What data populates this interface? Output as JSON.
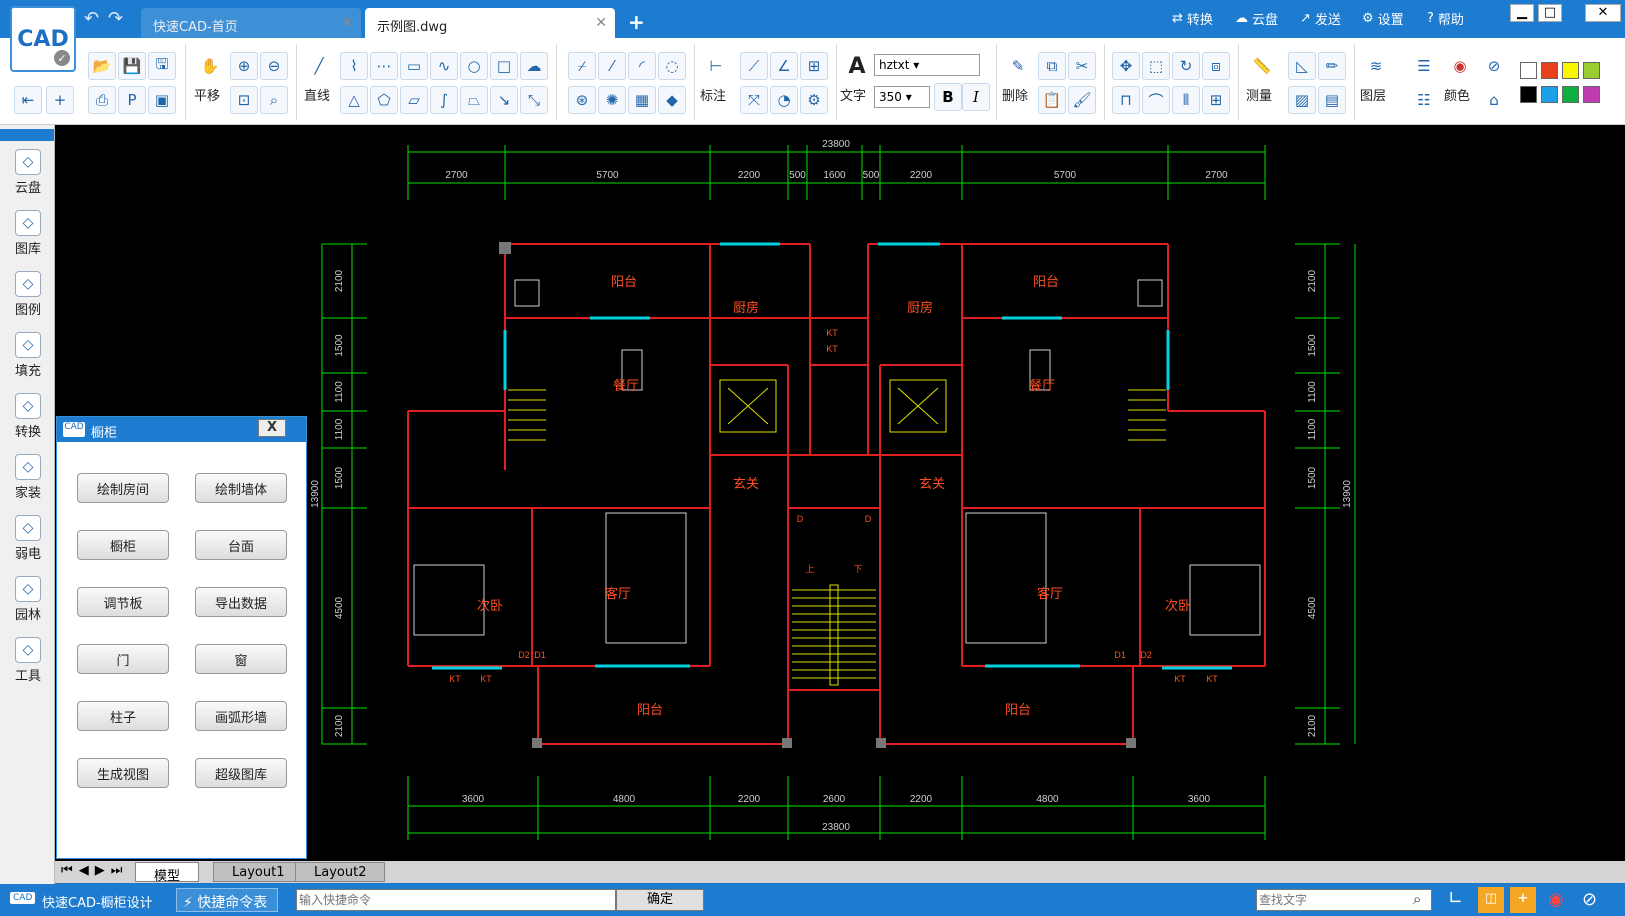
{
  "title_tabs": [
    {
      "label": "快速CAD-首页"
    },
    {
      "label": "示例图.dwg"
    }
  ],
  "top_right": {
    "convert": "转换",
    "cloud": "云盘",
    "send": "发送",
    "settings": "设置",
    "help": "帮助"
  },
  "ribbon": {
    "pan": "平移",
    "line": "直线",
    "dimension": "标注",
    "text": "文字",
    "font": "hztxt",
    "size": "350",
    "bold": "B",
    "italic": "I",
    "delete": "删除",
    "measure": "测量",
    "layer": "图层",
    "color": "颜色"
  },
  "swatches": [
    "#ffffff",
    "#e8401c",
    "#f8f800",
    "#9acd32",
    "#000000",
    "#1ea0e8",
    "#10b040",
    "#c03ab0"
  ],
  "leftbar": [
    {
      "label": "云盘",
      "icon": "cloud-icon"
    },
    {
      "label": "图库",
      "icon": "gallery-icon"
    },
    {
      "label": "图例",
      "icon": "legend-icon"
    },
    {
      "label": "填充",
      "icon": "hatch-icon"
    },
    {
      "label": "转换",
      "icon": "convert-icon"
    },
    {
      "label": "家装",
      "icon": "home-icon"
    },
    {
      "label": "弱电",
      "icon": "lowvoltage-icon"
    },
    {
      "label": "园林",
      "icon": "garden-icon"
    },
    {
      "label": "工具",
      "icon": "tools-icon"
    }
  ],
  "panel": {
    "title": "橱柜",
    "close": "X",
    "buttons": [
      "绘制房间",
      "绘制墙体",
      "橱柜",
      "台面",
      "调节板",
      "导出数据",
      "门",
      "窗",
      "柱子",
      "画弧形墙",
      "生成视图",
      "超级图库"
    ]
  },
  "drawing": {
    "total": "23800",
    "top_dims": [
      "2700",
      "5700",
      "2200",
      "500",
      "1600",
      "500",
      "2200",
      "5700",
      "2700"
    ],
    "bottom_dims": [
      "3600",
      "4800",
      "2200",
      "2600",
      "2200",
      "4800",
      "3600"
    ],
    "side_dims": [
      "2100",
      "1500",
      "1100",
      "1100",
      "1500",
      "4500",
      "2100"
    ],
    "side_total": "13900",
    "rooms": [
      "阳台",
      "厨房",
      "餐厅",
      "玄关",
      "次卧",
      "客厅",
      "阳台",
      "阳台",
      "厨房",
      "餐厅",
      "玄关",
      "客厅",
      "次卧",
      "阳台"
    ],
    "tags": [
      "KT",
      "KT",
      "D",
      "D",
      "D1",
      "D2",
      "D1",
      "D2",
      "KT",
      "KT",
      "KT",
      "KT",
      "上",
      "下"
    ]
  },
  "layouts": [
    "模型",
    "Layout1",
    "Layout2"
  ],
  "status": {
    "app": "快速CAD-橱柜设计",
    "cmd_table": "快捷命令表",
    "cmd_placeholder": "输入快捷命令",
    "ok": "确定",
    "search_placeholder": "查找文字"
  }
}
